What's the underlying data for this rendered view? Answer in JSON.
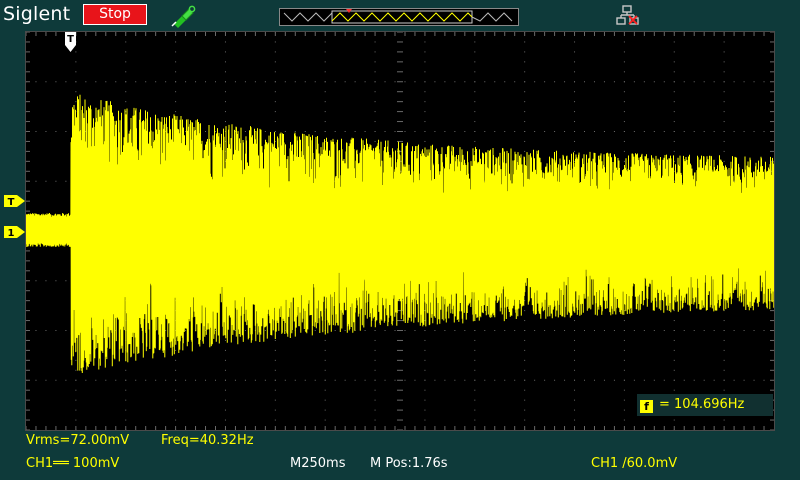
{
  "header": {
    "brand": "Siglent",
    "run_state": "Stop",
    "trigger_icon": "trigger-probe-icon",
    "network_icon": "network-icon",
    "run_state_color": "#e8141a"
  },
  "screen": {
    "background": "#000000",
    "grid_color": "#6a6a6a",
    "trace_color": "#ffff00",
    "h_divisions": 15,
    "v_divisions": 8
  },
  "markers": {
    "trigger_time": "T",
    "trigger_level": "T",
    "channel": "1"
  },
  "measurements": {
    "vrms": "Vrms=72.00mV",
    "freq": "Freq=40.32Hz",
    "counter": "= 104.696Hz",
    "counter_icon": "f"
  },
  "status": {
    "ch1_scale": "CH1══ 100mV",
    "timebase": "M250ms",
    "mpos": "M Pos:1.76s",
    "trigger": "CH1 /60.0mV"
  }
}
